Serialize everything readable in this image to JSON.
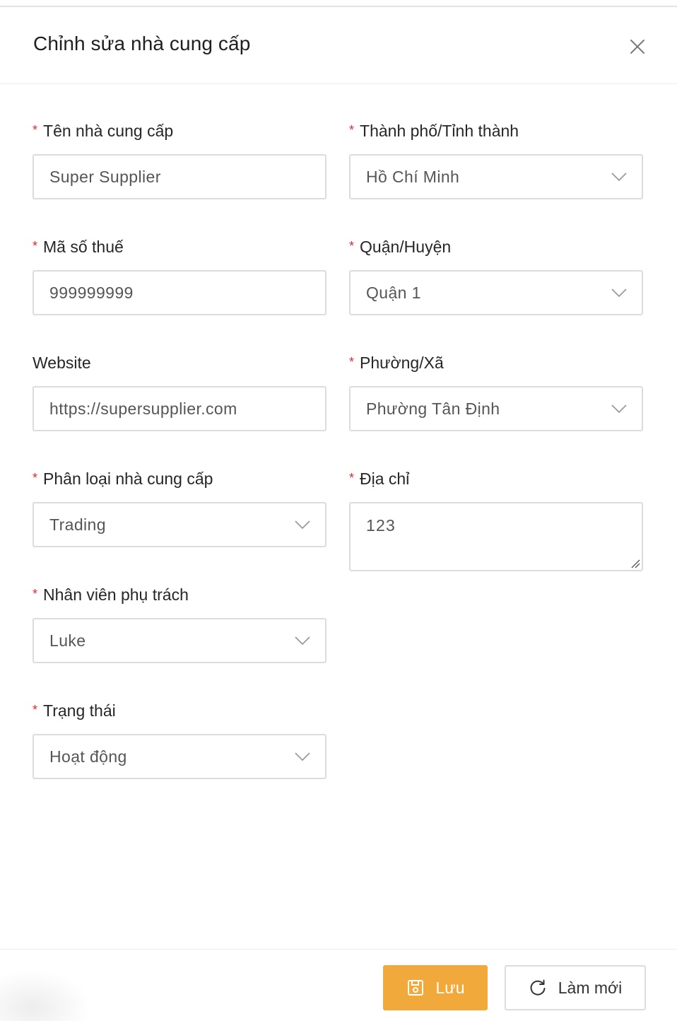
{
  "dialog": {
    "title": "Chỉnh sửa nhà cung cấp"
  },
  "required_marker": "*",
  "fields": {
    "name": {
      "label": "Tên nhà cung cấp",
      "value": "Super Supplier"
    },
    "tax_code": {
      "label": "Mã số thuế",
      "value": "999999999"
    },
    "website": {
      "label": "Website",
      "value": "https://supersupplier.com"
    },
    "category": {
      "label": "Phân loại nhà cung cấp",
      "value": "Trading"
    },
    "staff": {
      "label": "Nhân viên phụ trách",
      "value": "Luke"
    },
    "status": {
      "label": "Trạng thái",
      "value": "Hoạt động"
    },
    "city": {
      "label": "Thành phố/Tỉnh thành",
      "value": "Hồ Chí Minh"
    },
    "district": {
      "label": "Quận/Huyện",
      "value": "Quận 1"
    },
    "ward": {
      "label": "Phường/Xã",
      "value": "Phường Tân Định"
    },
    "address": {
      "label": "Địa chỉ",
      "value": "123"
    }
  },
  "footer": {
    "save_label": "Lưu",
    "reset_label": "Làm mới"
  },
  "colors": {
    "primary": "#f0a93a",
    "required": "#f5222d",
    "border": "#dcdcdc"
  },
  "icons": {
    "close": "close-icon",
    "dropdown": "chevron-down-icon",
    "save": "save-icon",
    "reset": "refresh-icon"
  }
}
